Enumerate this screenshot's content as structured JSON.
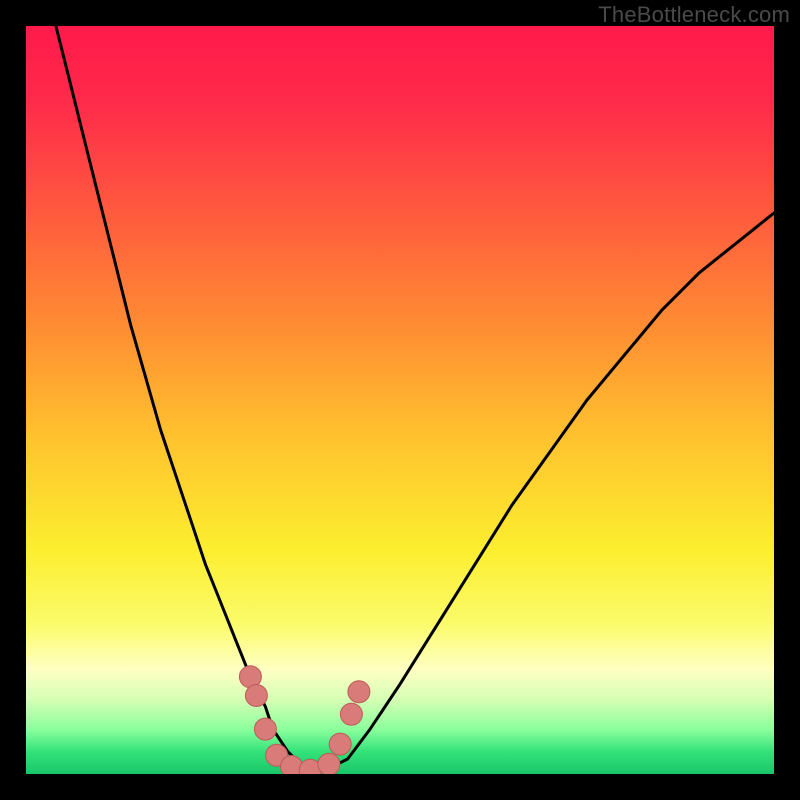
{
  "watermark": "TheBottleneck.com",
  "colors": {
    "frame": "#000000",
    "watermark": "#4a4a4a",
    "gradient_stops": [
      {
        "offset": 0.0,
        "color": "#ff1a4b"
      },
      {
        "offset": 0.1,
        "color": "#ff2a4a"
      },
      {
        "offset": 0.25,
        "color": "#ff5a3e"
      },
      {
        "offset": 0.4,
        "color": "#ff8c33"
      },
      {
        "offset": 0.55,
        "color": "#ffc22e"
      },
      {
        "offset": 0.7,
        "color": "#fcee2f"
      },
      {
        "offset": 0.8,
        "color": "#fbfb6b"
      },
      {
        "offset": 0.86,
        "color": "#ffffc4"
      },
      {
        "offset": 0.9,
        "color": "#d6ffb4"
      },
      {
        "offset": 0.94,
        "color": "#8cff9d"
      },
      {
        "offset": 0.97,
        "color": "#34e27a"
      },
      {
        "offset": 1.0,
        "color": "#18c66a"
      }
    ],
    "curve": "#000000",
    "marker_fill": "#d97b79",
    "marker_stroke": "#be5a58"
  },
  "chart_data": {
    "type": "line",
    "title": "",
    "xlabel": "",
    "ylabel": "",
    "xlim": [
      0,
      100
    ],
    "ylim": [
      0,
      100
    ],
    "series": [
      {
        "name": "bottleneck-curve",
        "x": [
          4,
          6,
          8,
          10,
          12,
          14,
          16,
          18,
          20,
          22,
          24,
          26,
          28,
          30,
          32,
          33,
          35,
          37,
          38,
          40,
          43,
          46,
          50,
          55,
          60,
          65,
          70,
          75,
          80,
          85,
          90,
          95,
          100
        ],
        "y": [
          100,
          92,
          84,
          76,
          68,
          60,
          53,
          46,
          40,
          34,
          28,
          23,
          18,
          13,
          9,
          6,
          3,
          1,
          0.3,
          0.5,
          2,
          6,
          12,
          20,
          28,
          36,
          43,
          50,
          56,
          62,
          67,
          71,
          75
        ]
      }
    ],
    "markers": [
      {
        "x": 30.0,
        "y": 13.0
      },
      {
        "x": 30.8,
        "y": 10.5
      },
      {
        "x": 32.0,
        "y": 6.0
      },
      {
        "x": 33.5,
        "y": 2.5
      },
      {
        "x": 35.5,
        "y": 1.0
      },
      {
        "x": 38.0,
        "y": 0.5
      },
      {
        "x": 40.5,
        "y": 1.3
      },
      {
        "x": 42.0,
        "y": 4.0
      },
      {
        "x": 43.5,
        "y": 8.0
      },
      {
        "x": 44.5,
        "y": 11.0
      }
    ],
    "marker_radius_px": 11,
    "background_meaning": "vertical heat gradient: red=high bottleneck at top, green=low bottleneck at bottom"
  }
}
